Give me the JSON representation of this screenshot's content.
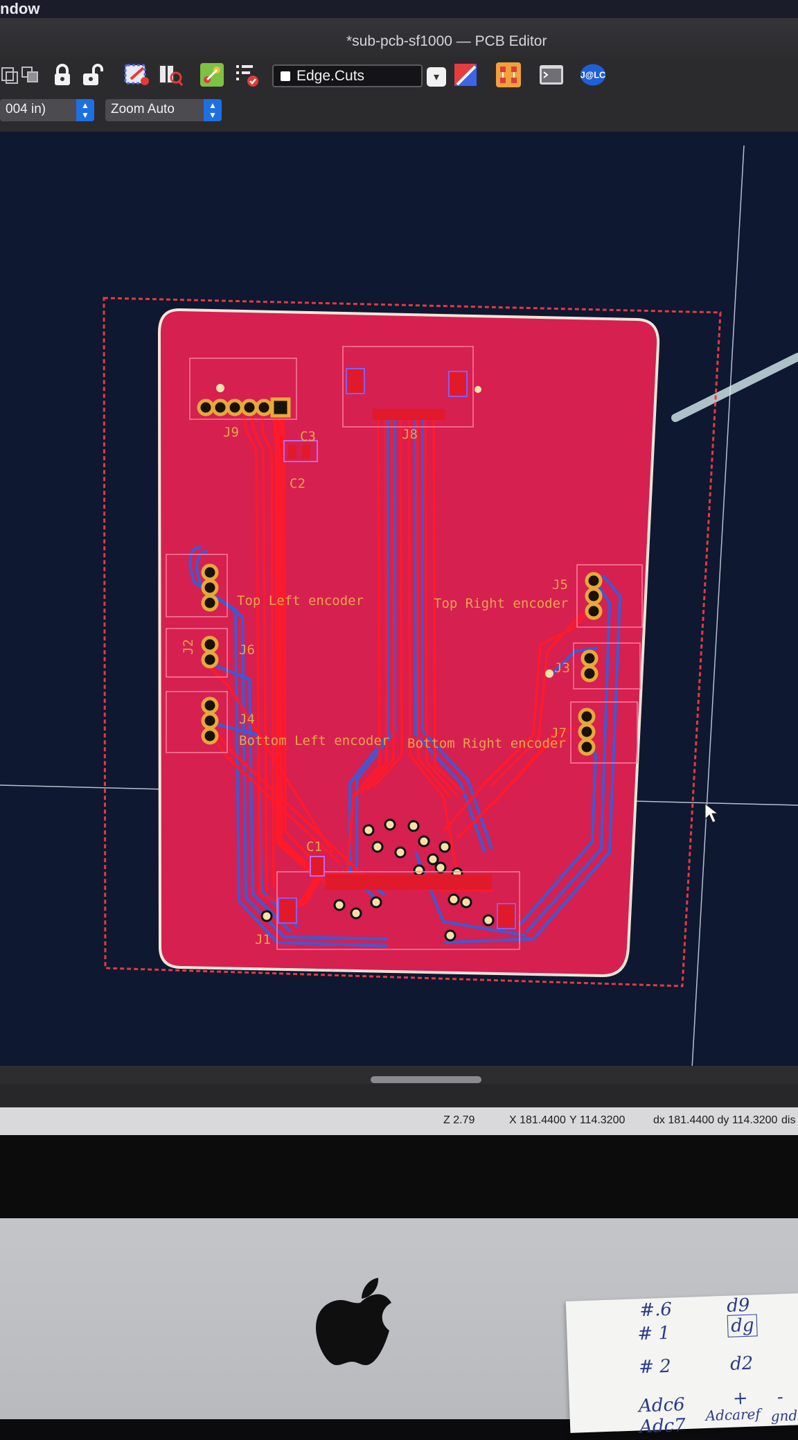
{
  "menubar": {
    "window_menu": "ndow"
  },
  "window": {
    "title": "*sub-pcb-sf1000 — PCB Editor"
  },
  "toolbar": {
    "layer_select_value": "Edge.Cuts",
    "icons": [
      "move-icon",
      "group-icon",
      "lock-icon",
      "unlock-icon",
      "drc-icon",
      "inspect-icon",
      "netlist-icon",
      "checklist-icon",
      "layer-pair-icon",
      "footprint-icon",
      "scripting-console-icon",
      "jlcpcb-plugin-icon"
    ],
    "jlc_label": "J@LC"
  },
  "toolbar2": {
    "grid_select_value": "004 in)",
    "zoom_select_value": "Zoom Auto"
  },
  "pcb": {
    "board_color": "#d6204f",
    "refs": {
      "j9": "J9",
      "c3": "C3",
      "c2": "C2",
      "j8": "J8",
      "j5": "J5",
      "j2": "J2",
      "j6": "J6",
      "j3": "J3",
      "j4": "J4",
      "j7": "J7",
      "c1": "C1",
      "j1": "J1"
    },
    "labels": {
      "top_left": "Top Left encoder",
      "top_right": "Top Right encoder",
      "bottom_left": "Bottom Left encoder",
      "bottom_right": "Bottom Right encoder"
    }
  },
  "status": {
    "zoom": "Z 2.79",
    "x": "X 181.4400",
    "y": "Y 114.3200",
    "dxdy": "dx 181.4400  dy 114.3200",
    "dist": "dis"
  },
  "note": {
    "lines": [
      "#.6",
      "# 1",
      "# 2",
      "Adc6",
      "Adc7"
    ],
    "col2": [
      "d9",
      "dg",
      "d2",
      "+",
      "Adcaref"
    ],
    "col3": [
      "-",
      "gnd"
    ]
  }
}
